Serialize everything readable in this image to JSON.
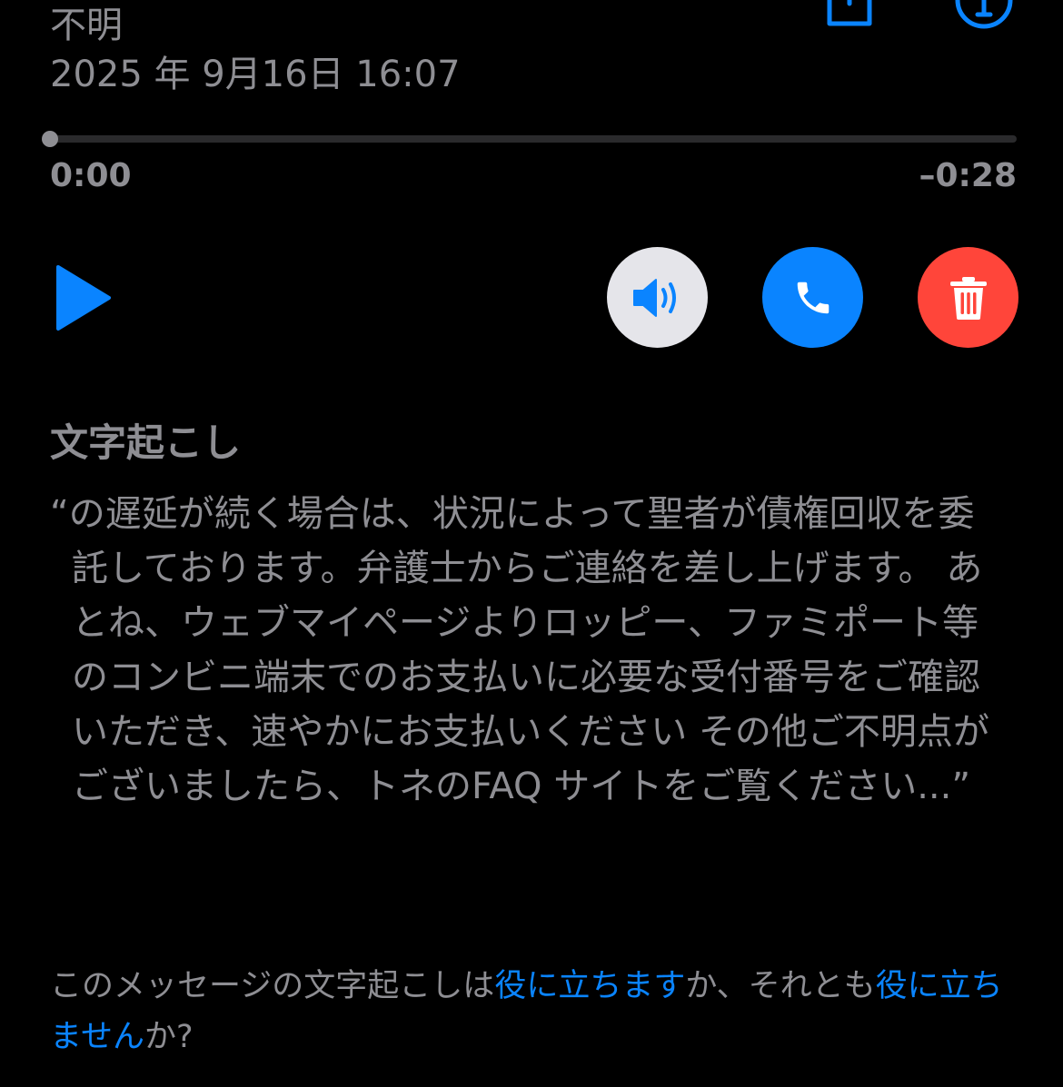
{
  "header": {
    "caller": "不明",
    "datetime": "2025 年 9月16日 16:07"
  },
  "playback": {
    "elapsed": "0:00",
    "remaining": "–0:28",
    "progress_fraction": 0
  },
  "transcript": {
    "title": "文字起こし",
    "text": "“の遅延が続く場合は、状況によって聖者が債権回収を委託しております。弁護士からご連絡を差し上げます。 あとね、ウェブマイページよりロッピー、ファミポート等のコンビニ端末でのお支払いに必要な受付番号をご確認いただき、速やかにお支払いください その他ご不明点がございましたら、トネのFAQ サイトをご覧ください...”"
  },
  "feedback": {
    "prefix": "このメッセージの文字起こしは",
    "helpful_link": "役に立ちます",
    "middle": "か、それとも",
    "not_helpful_link": "役に立ちません",
    "suffix": "か?"
  },
  "colors": {
    "background": "#000000",
    "text_secondary": "#8e8e93",
    "accent_blue": "#0a84ff",
    "delete_red": "#ff453a",
    "speaker_bg": "#e5e5ea"
  },
  "icons": {
    "share": "share-icon",
    "info": "info-icon",
    "play": "play-icon",
    "speaker": "speaker-icon",
    "call": "phone-icon",
    "delete": "trash-icon"
  }
}
